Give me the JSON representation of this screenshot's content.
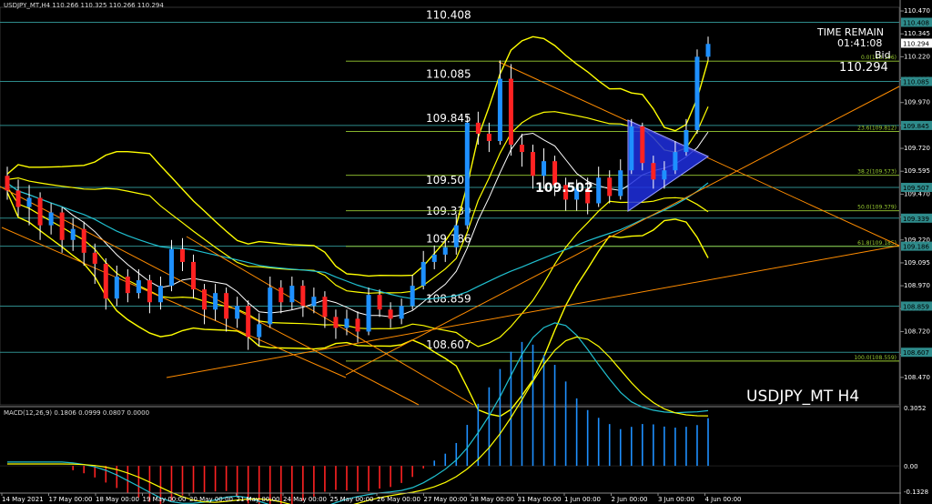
{
  "header": {
    "text": "USDJPY_MT,H4  110.266 110.325 110.266 110.294"
  },
  "timer": {
    "label": "TIME REMAIN",
    "value": "01:41:08",
    "bid_label": "Bid",
    "bid_value": "110.294"
  },
  "symbol_label": "USDJPY_MT H4",
  "macd": {
    "label": "MACD(12,26,9) 0.1806 0.0999 0.0807 0.0000"
  },
  "colors": {
    "background": "#000000",
    "bull": "#1e90ff",
    "bear": "#ff2222",
    "level": "#2e8b8b",
    "fib": "#9acd32",
    "trend": "#ff8c00",
    "bands": "#ffff00",
    "triangle": "#1f2fe0"
  },
  "chart_data": {
    "type": "candlestick",
    "symbol": "USDJPY_MT",
    "timeframe": "H4",
    "ylim": [
      108.32,
      110.49
    ],
    "price_ticks": [
      "110.470",
      "110.345",
      "110.220",
      "110.095",
      "109.970",
      "109.845",
      "109.720",
      "109.595",
      "109.470",
      "109.345",
      "109.220",
      "109.095",
      "108.970",
      "108.845",
      "108.720",
      "108.595",
      "108.470"
    ],
    "x_ticks": [
      "14 May 2021",
      "17 May 00:00",
      "18 May 00:00",
      "19 May 00:00",
      "20 May 00:00",
      "21 May 00:00",
      "24 May 00:00",
      "25 May 00:00",
      "26 May 00:00",
      "27 May 00:00",
      "28 May 00:00",
      "31 May 00:00",
      "1 Jun 00:00",
      "2 Jun 00:00",
      "3 Jun 00:00",
      "4 Jun 00:00"
    ],
    "levels": [
      {
        "price": 110.408,
        "label": "110.408",
        "tag": "110.408"
      },
      {
        "price": 110.085,
        "label": "110.085",
        "tag": "110.085"
      },
      {
        "price": 109.845,
        "label": "109.845",
        "tag": "109.845"
      },
      {
        "price": 109.507,
        "label": "109.507",
        "tag": "109.507"
      },
      {
        "price": 109.339,
        "label": "109.339",
        "tag": "109.339"
      },
      {
        "price": 109.186,
        "label": "109.186",
        "tag": "109.186"
      },
      {
        "price": 108.859,
        "label": "108.859",
        "tag": "108.859"
      },
      {
        "price": 108.607,
        "label": "108.607",
        "tag": "108.607"
      }
    ],
    "fib_labels": [
      {
        "price": 110.196,
        "text": "0.0(110.196)"
      },
      {
        "price": 109.812,
        "text": "23.6(109.812)"
      },
      {
        "price": 109.573,
        "text": "38.2(109.573)"
      },
      {
        "price": 109.379,
        "text": "50.0(109.379)"
      },
      {
        "price": 109.185,
        "text": "61.8(109.185)"
      },
      {
        "price": 108.559,
        "text": "100.0(108.559)"
      }
    ],
    "current_price": {
      "price": 110.294,
      "tag": "110.294"
    },
    "annotation": {
      "text": "109.502",
      "price": 109.502
    },
    "candles": [
      [
        109.57,
        109.49,
        109.62,
        109.44
      ],
      [
        109.49,
        109.4,
        109.55,
        109.35
      ],
      [
        109.4,
        109.45,
        109.52,
        109.3
      ],
      [
        109.45,
        109.3,
        109.48,
        109.22
      ],
      [
        109.3,
        109.37,
        109.42,
        109.25
      ],
      [
        109.37,
        109.22,
        109.4,
        109.15
      ],
      [
        109.22,
        109.28,
        109.34,
        109.16
      ],
      [
        109.28,
        109.15,
        109.32,
        109.08
      ],
      [
        109.15,
        109.09,
        109.2,
        108.98
      ],
      [
        109.09,
        108.9,
        109.12,
        108.84
      ],
      [
        108.9,
        109.02,
        109.08,
        108.86
      ],
      [
        109.02,
        108.93,
        109.06,
        108.88
      ],
      [
        108.93,
        109.0,
        109.06,
        108.9
      ],
      [
        109.0,
        108.88,
        109.03,
        108.82
      ],
      [
        108.88,
        108.97,
        109.02,
        108.84
      ],
      [
        108.97,
        109.17,
        109.22,
        108.94
      ],
      [
        109.17,
        109.1,
        109.23,
        109.05
      ],
      [
        109.1,
        108.95,
        109.14,
        108.9
      ],
      [
        108.95,
        108.84,
        108.98,
        108.76
      ],
      [
        108.84,
        108.93,
        108.98,
        108.78
      ],
      [
        108.93,
        108.79,
        108.96,
        108.72
      ],
      [
        108.79,
        108.86,
        108.91,
        108.74
      ],
      [
        108.86,
        108.69,
        108.89,
        108.62
      ],
      [
        108.69,
        108.76,
        108.82,
        108.64
      ],
      [
        108.76,
        108.96,
        109.02,
        108.74
      ],
      [
        108.96,
        108.88,
        109.0,
        108.82
      ],
      [
        108.88,
        108.97,
        109.02,
        108.84
      ],
      [
        108.97,
        108.86,
        109.0,
        108.8
      ],
      [
        108.86,
        108.91,
        108.96,
        108.82
      ],
      [
        108.91,
        108.8,
        108.94,
        108.74
      ],
      [
        108.8,
        108.74,
        108.84,
        108.68
      ],
      [
        108.74,
        108.79,
        108.84,
        108.7
      ],
      [
        108.79,
        108.72,
        108.83,
        108.66
      ],
      [
        108.72,
        108.92,
        108.96,
        108.7
      ],
      [
        108.92,
        108.84,
        108.95,
        108.8
      ],
      [
        108.84,
        108.79,
        108.88,
        108.74
      ],
      [
        108.79,
        108.86,
        108.9,
        108.76
      ],
      [
        108.86,
        108.97,
        109.03,
        108.84
      ],
      [
        108.97,
        109.1,
        109.16,
        108.95
      ],
      [
        109.1,
        109.14,
        109.19,
        109.06
      ],
      [
        109.14,
        109.18,
        109.24,
        109.1
      ],
      [
        109.18,
        109.3,
        109.36,
        109.14
      ],
      [
        109.3,
        109.86,
        109.9,
        109.28
      ],
      [
        109.86,
        109.8,
        109.92,
        109.74
      ],
      [
        109.8,
        109.76,
        109.86,
        109.7
      ],
      [
        109.76,
        110.1,
        110.2,
        109.74
      ],
      [
        110.1,
        109.74,
        110.18,
        109.68
      ],
      [
        109.74,
        109.7,
        109.8,
        109.62
      ],
      [
        109.7,
        109.57,
        109.74,
        109.5
      ],
      [
        109.57,
        109.65,
        109.72,
        109.5
      ],
      [
        109.65,
        109.52,
        109.68,
        109.46
      ],
      [
        109.52,
        109.44,
        109.56,
        109.38
      ],
      [
        109.44,
        109.5,
        109.55,
        109.38
      ],
      [
        109.5,
        109.42,
        109.56,
        109.36
      ],
      [
        109.42,
        109.56,
        109.62,
        109.4
      ],
      [
        109.56,
        109.46,
        109.6,
        109.42
      ],
      [
        109.46,
        109.6,
        109.66,
        109.44
      ],
      [
        109.6,
        109.84,
        109.88,
        109.58
      ],
      [
        109.84,
        109.64,
        109.86,
        109.6
      ],
      [
        109.64,
        109.55,
        109.68,
        109.5
      ],
      [
        109.55,
        109.6,
        109.65,
        109.5
      ],
      [
        109.6,
        109.7,
        109.76,
        109.58
      ],
      [
        109.7,
        109.82,
        109.88,
        109.68
      ],
      [
        109.82,
        110.22,
        110.26,
        109.8
      ],
      [
        110.22,
        110.29,
        110.33,
        110.2
      ]
    ],
    "macd": {
      "zero_value": "0.0000",
      "ticks": [
        "0.3052",
        "0.00",
        "-0.1328"
      ],
      "ylim": [
        -0.1328,
        0.3052
      ]
    }
  }
}
